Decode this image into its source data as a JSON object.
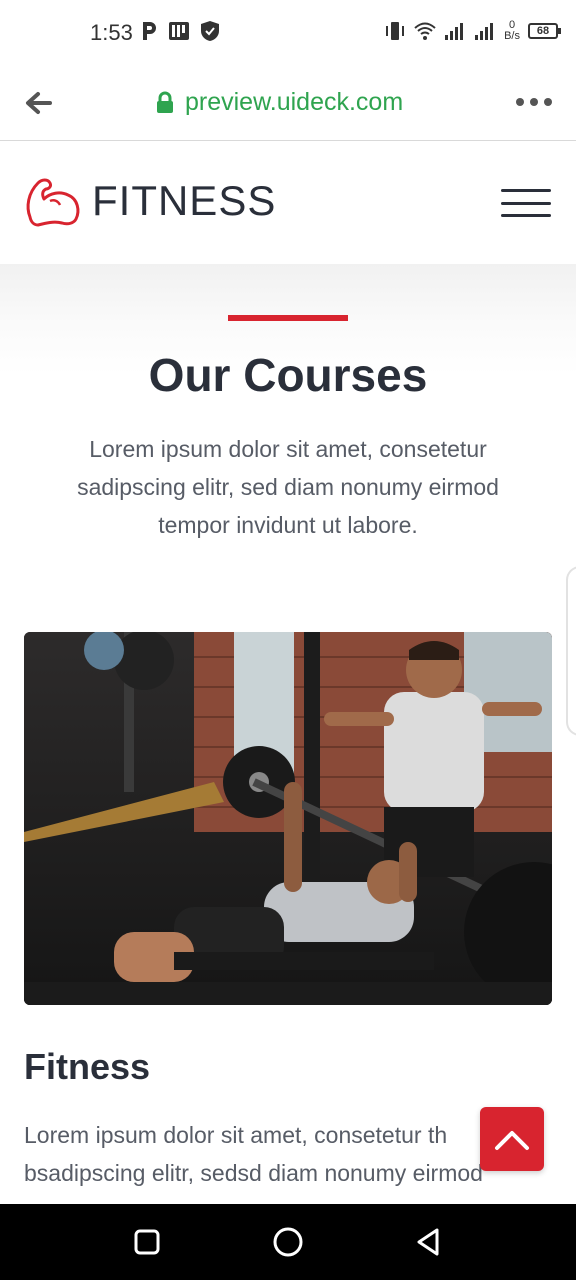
{
  "status_bar": {
    "time": "1:53",
    "net_speed_value": "0",
    "net_speed_unit": "B/s",
    "battery": "68",
    "icons": [
      "parking-icon",
      "presentation-icon",
      "shield-icon",
      "vibrate-icon",
      "wifi-icon",
      "signal-icon",
      "signal-icon"
    ]
  },
  "browser": {
    "url": "preview.uideck.com",
    "url_color": "#2fa44f",
    "icons": [
      "back-arrow-icon",
      "lock-icon",
      "more-options-icon"
    ]
  },
  "header": {
    "logo_text": "FITNESS",
    "logo_icon": "flexed-arm-icon",
    "menu_icon": "hamburger-menu-icon"
  },
  "section": {
    "title": "Our Courses",
    "description": "Lorem ipsum dolor sit amet, consetetur sadipscing elitr, sed diam nonumy eirmod tempor invidunt ut labore.",
    "accent_color": "#d8242f"
  },
  "course": {
    "image_alt": "gym-bench-press-photo",
    "title": "Fitness",
    "description": "Lorem ipsum dolor sit amet, consetetur th bsadipscing elitr, sedsd diam nonumy eirmod"
  },
  "scroll_top_icon": "chevron-up-icon",
  "nav_bar": {
    "icons": [
      "recents-square-icon",
      "home-circle-icon",
      "back-triangle-icon"
    ]
  }
}
